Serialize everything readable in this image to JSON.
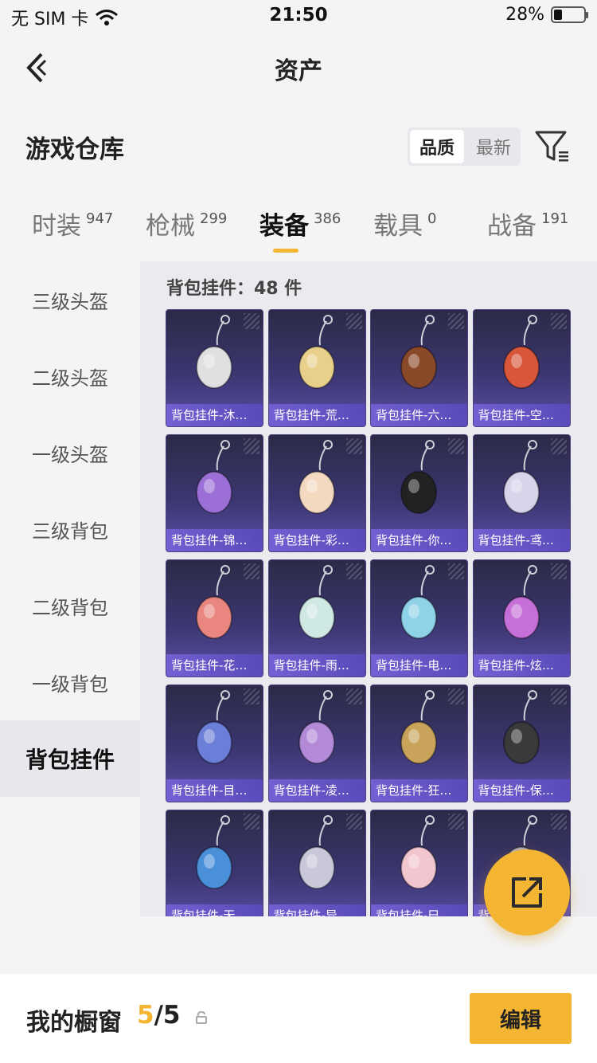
{
  "status_bar": {
    "carrier": "无 SIM 卡",
    "time": "21:50",
    "battery": "28%",
    "battery_level": 0.28
  },
  "nav": {
    "title": "资产",
    "back_icon": "chevron-left-icon"
  },
  "header": {
    "title": "游戏仓库",
    "sort_options": [
      "品质",
      "最新"
    ],
    "sort_active": "品质",
    "filter_icon": "filter-icon"
  },
  "tabs": [
    {
      "label": "时装",
      "count": "947"
    },
    {
      "label": "枪械",
      "count": "299"
    },
    {
      "label": "装备",
      "count": "386",
      "active": true
    },
    {
      "label": "载具",
      "count": "0"
    },
    {
      "label": "战备",
      "count": "191"
    }
  ],
  "sidebar": {
    "items": [
      {
        "label": "三级头盔"
      },
      {
        "label": "二级头盔"
      },
      {
        "label": "一级头盔"
      },
      {
        "label": "三级背包"
      },
      {
        "label": "二级背包"
      },
      {
        "label": "一级背包"
      },
      {
        "label": "背包挂件",
        "active": true
      }
    ]
  },
  "content": {
    "count_label": "背包挂件：48 件",
    "items": [
      {
        "label": "背包挂件-沐…",
        "icon": "cat-charm-icon",
        "color": "#e0e0e0"
      },
      {
        "label": "背包挂件-荒…",
        "icon": "sun-charm-icon",
        "color": "#e8d08a"
      },
      {
        "label": "背包挂件-六…",
        "icon": "bird-charm-icon",
        "color": "#8a4a2a"
      },
      {
        "label": "背包挂件-空…",
        "icon": "pistol-charm-icon",
        "color": "#d9563a"
      },
      {
        "label": "背包挂件-锦…",
        "icon": "feather-charm-icon",
        "color": "#9b6fd6"
      },
      {
        "label": "背包挂件-彩…",
        "icon": "icecream-charm-icon",
        "color": "#f3d9c0"
      },
      {
        "label": "背包挂件-你…",
        "icon": "penguin-charm-icon",
        "color": "#222222"
      },
      {
        "label": "背包挂件-鸢…",
        "icon": "butterfly-charm-icon",
        "color": "#d8d4ea"
      },
      {
        "label": "背包挂件-花…",
        "icon": "omamori-charm-icon",
        "color": "#e9867f"
      },
      {
        "label": "背包挂件-雨…",
        "icon": "wand-charm-icon",
        "color": "#cfe8e4"
      },
      {
        "label": "背包挂件-电…",
        "icon": "arcade-charm-icon",
        "color": "#8fd3e8"
      },
      {
        "label": "背包挂件-炫…",
        "icon": "candy-charm-icon",
        "color": "#c66fd8"
      },
      {
        "label": "背包挂件-目…",
        "icon": "ring-charm-icon",
        "color": "#6b7fd8"
      },
      {
        "label": "背包挂件-凌…",
        "icon": "crescent-charm-icon",
        "color": "#b28ad8"
      },
      {
        "label": "背包挂件-狂…",
        "icon": "blade-charm-icon",
        "color": "#c9a35a"
      },
      {
        "label": "背包挂件-保…",
        "icon": "lighter-charm-icon",
        "color": "#3a3a3a"
      },
      {
        "label": "背包挂件-无…",
        "icon": "gem-charm-icon",
        "color": "#4a90d9"
      },
      {
        "label": "背包挂件-异…",
        "icon": "wings-charm-icon",
        "color": "#c8c8d8"
      },
      {
        "label": "背包挂件-巳…",
        "icon": "fox-charm-icon",
        "color": "#f2c6cf"
      },
      {
        "label": "背包挂件-…",
        "icon": "charm-icon",
        "color": "#b0b0c0"
      }
    ]
  },
  "fab": {
    "icon": "share-icon"
  },
  "showcase": {
    "title": "我的橱窗",
    "current": "5",
    "separator": "/",
    "total": "5",
    "lock_icon": "lock-icon",
    "edit_label": "编辑"
  },
  "colors": {
    "accent": "#f4b532",
    "card_top": "#2c2a47",
    "card_bottom": "#5b4ea6"
  }
}
